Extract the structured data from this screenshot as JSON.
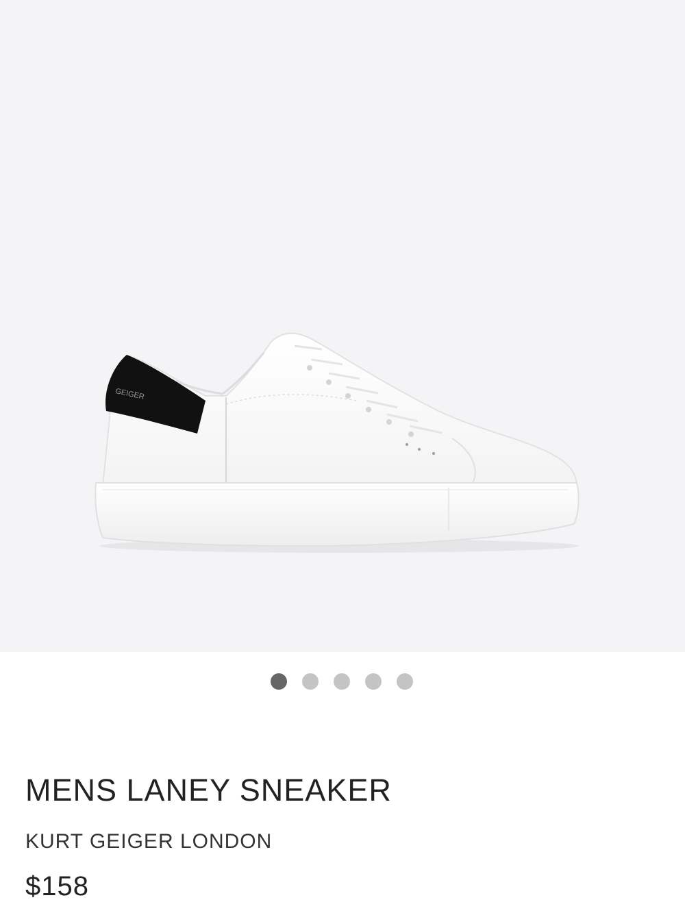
{
  "gallery": {
    "image_alt": "MENS LANEY SNEAKER",
    "heel_tab_text": "GEIGER",
    "slide_count": 5,
    "active_slide": 1,
    "colors": {
      "background": "#f4f4f6",
      "shoe_upper": "#ffffff",
      "heel_tab": "#111111",
      "dot_active": "#666666",
      "dot_inactive": "#c4c4c4"
    }
  },
  "product": {
    "title": "MENS LANEY SNEAKER",
    "brand": "KURT GEIGER LONDON",
    "price": "$158"
  }
}
